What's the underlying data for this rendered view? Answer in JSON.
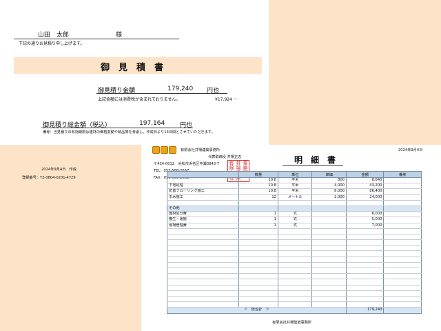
{
  "cover": {
    "customer_name": "山田　太郎",
    "honorific": "様",
    "intro_text": "下記の通りお見積り申し上げます。",
    "title": "御　見　積　書",
    "amount_label": "御見積り金額",
    "amount_value": "179,240",
    "amount_unit": "円也",
    "tax_note": "上記金額には消費税が含まれておりません。",
    "tax_value": "¥17,924 －",
    "total_label": "御見積り総金額（税込）",
    "total_value": "197,164",
    "total_unit": "円也",
    "remark": "備考：当見積りの有効期限は建材の価格変動や納品等を考慮し、作成日より14日間とさせていただきます。",
    "date_created": "2024年9月4日　作成",
    "registration": "登録番号：T2-0804-0201-4729"
  },
  "detail": {
    "company": "有限会社井場建築事務所",
    "representative": "代表取締役 井場正志",
    "address": "〒434-0012　浜松市浜名区中瀬3843-7",
    "tel": "TEL：053-588-2697",
    "fax": "FAX：053-588-2862",
    "date": "2024年9月4日",
    "title": "明　細　書",
    "seal_chars": [
      "有",
      "井",
      "事",
      "限",
      "場",
      "務",
      "会",
      "建",
      "所",
      "社",
      "築",
      ""
    ],
    "columns": [
      "",
      "数量",
      "単位",
      "単価",
      "金額",
      "備考"
    ],
    "rows": [
      {
        "name": "",
        "qty": "10.8",
        "unit": "平米",
        "price": "800",
        "amount": "8,640",
        "note": "",
        "section": false
      },
      {
        "name": "下地処理",
        "qty": "10.8",
        "unit": "平米",
        "price": "4,000",
        "amount": "43,200",
        "note": "",
        "section": false
      },
      {
        "name": "防音フローリング施工",
        "qty": "10.8",
        "unit": "平米",
        "price": "8,000",
        "amount": "86,400",
        "note": "",
        "section": false
      },
      {
        "name": "巾木施工",
        "qty": "12",
        "unit": "メートル",
        "price": "2,000",
        "amount": "24,000",
        "note": "",
        "section": false
      },
      {
        "name": "",
        "qty": "",
        "unit": "",
        "price": "",
        "amount": "",
        "note": "",
        "section": false
      },
      {
        "name": "その他",
        "qty": "",
        "unit": "",
        "price": "",
        "amount": "",
        "note": "",
        "section": true
      },
      {
        "name": "廃材処分費",
        "qty": "1",
        "unit": "式",
        "price": "",
        "amount": "6,000",
        "note": "",
        "section": false
      },
      {
        "name": "養生・運搬",
        "qty": "1",
        "unit": "式",
        "price": "",
        "amount": "5,000",
        "note": "",
        "section": false
      },
      {
        "name": "現場管理費",
        "qty": "1",
        "unit": "式",
        "price": "",
        "amount": "7,000",
        "note": "",
        "section": false
      },
      {
        "name": "",
        "qty": "",
        "unit": "",
        "price": "",
        "amount": "",
        "note": "",
        "section": false
      },
      {
        "name": "",
        "qty": "",
        "unit": "",
        "price": "",
        "amount": "",
        "note": "",
        "section": false
      },
      {
        "name": "",
        "qty": "",
        "unit": "",
        "price": "",
        "amount": "",
        "note": "",
        "section": false
      },
      {
        "name": "",
        "qty": "",
        "unit": "",
        "price": "",
        "amount": "",
        "note": "",
        "section": false
      },
      {
        "name": "",
        "qty": "",
        "unit": "",
        "price": "",
        "amount": "",
        "note": "",
        "section": false
      },
      {
        "name": "",
        "qty": "",
        "unit": "",
        "price": "",
        "amount": "",
        "note": "",
        "section": false
      },
      {
        "name": "",
        "qty": "",
        "unit": "",
        "price": "",
        "amount": "",
        "note": "",
        "section": false
      },
      {
        "name": "",
        "qty": "",
        "unit": "",
        "price": "",
        "amount": "",
        "note": "",
        "section": false
      },
      {
        "name": "",
        "qty": "",
        "unit": "",
        "price": "",
        "amount": "",
        "note": "",
        "section": false
      },
      {
        "name": "",
        "qty": "",
        "unit": "",
        "price": "",
        "amount": "",
        "note": "",
        "section": false
      },
      {
        "name": "",
        "qty": "",
        "unit": "",
        "price": "",
        "amount": "",
        "note": "",
        "section": false
      },
      {
        "name": "",
        "qty": "",
        "unit": "",
        "price": "",
        "amount": "",
        "note": "",
        "section": false
      },
      {
        "name": "",
        "qty": "",
        "unit": "",
        "price": "",
        "amount": "",
        "note": "",
        "section": false
      },
      {
        "name": "",
        "qty": "",
        "unit": "",
        "price": "",
        "amount": "",
        "note": "",
        "section": false
      }
    ],
    "total_label": "＜　総合計　＞",
    "total_value": "179,240",
    "footer": "有限会社井場建築事務所"
  }
}
